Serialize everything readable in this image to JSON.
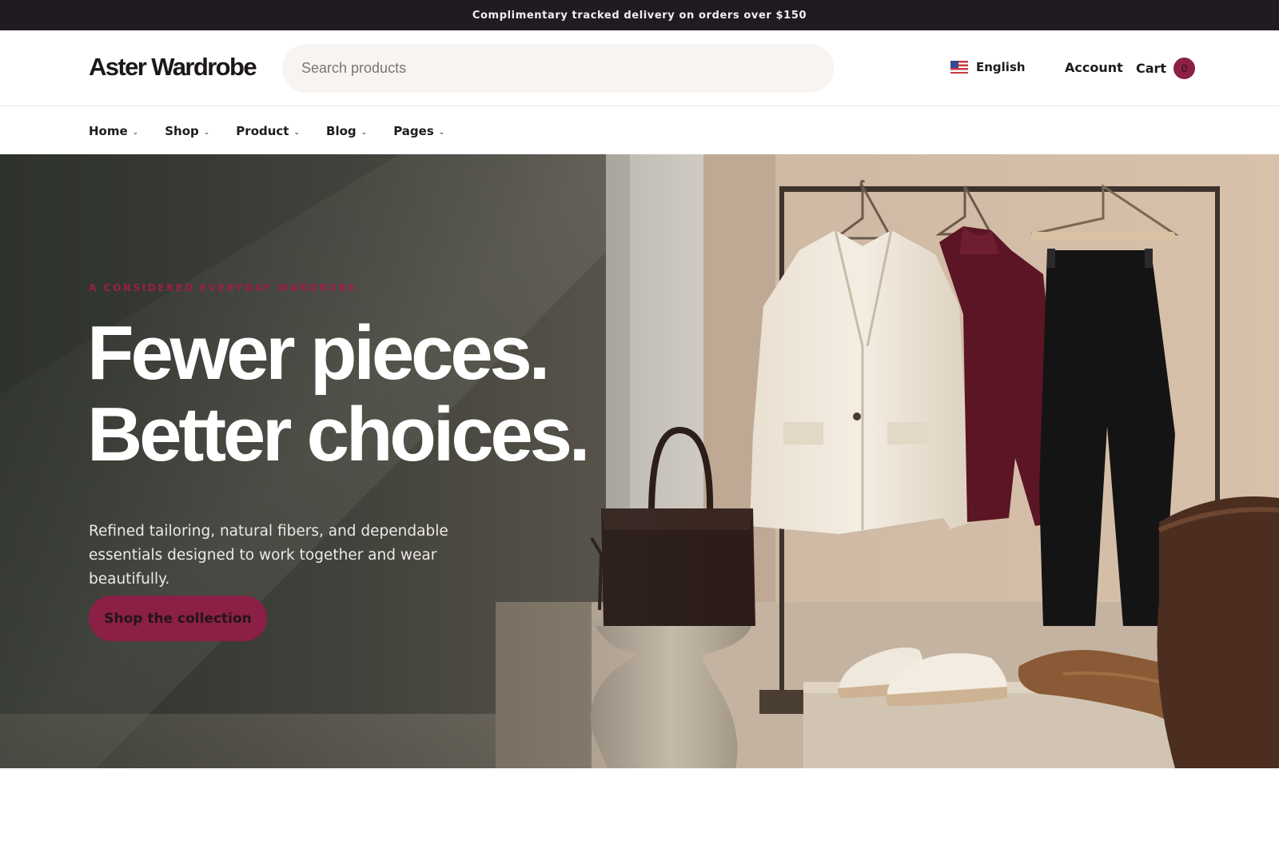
{
  "announcement": {
    "text": "Complimentary tracked delivery on orders over $150"
  },
  "header": {
    "logo": "Aster Wardrobe",
    "search_placeholder": "Search products",
    "language": "English",
    "language_flag_icon": "us-flag-icon",
    "account_label": "Account",
    "cart_label": "Cart",
    "cart_count": "0"
  },
  "nav": {
    "items": [
      {
        "label": "Home"
      },
      {
        "label": "Shop"
      },
      {
        "label": "Product"
      },
      {
        "label": "Blog"
      },
      {
        "label": "Pages"
      }
    ]
  },
  "hero": {
    "eyebrow": "A CONSIDERED EVERYDAY WARDROBE",
    "headline_line1": "Fewer pieces.",
    "headline_line2": "Better choices.",
    "subtext": "Refined tailoring, natural fibers, and dependable essentials designed to work together and wear beautifully.",
    "cta_label": "Shop the collection"
  },
  "colors": {
    "brand": "#8c1f45",
    "announcement_bg": "#221a21",
    "search_bg": "#f8f4f2"
  }
}
